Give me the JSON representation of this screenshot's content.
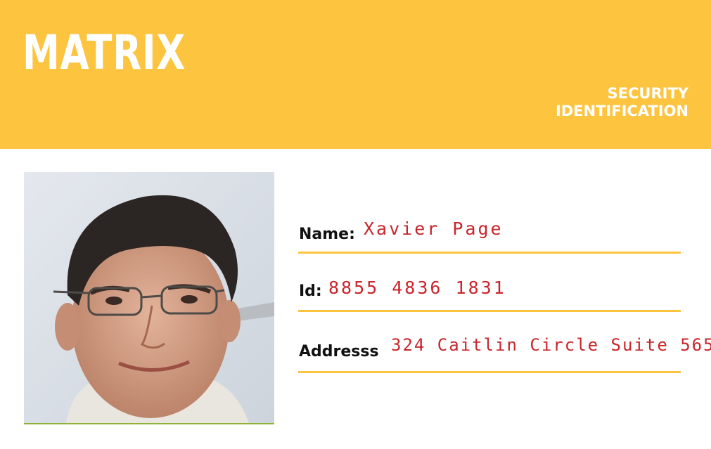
{
  "card": {
    "brand": "MATRIX",
    "subtitle_line1": "SECURITY",
    "subtitle_line2": "IDENTIFICATION",
    "colors": {
      "accent": "#fdc43f",
      "value_text": "#c9252b",
      "label_text": "#111111"
    }
  },
  "fields": {
    "name_label": "Name:",
    "name_value": "Xavier Page",
    "id_label": "Id:",
    "id_value": "8855 4836 1831",
    "address_label": "Addresss",
    "address_value": "324 Caitlin Circle Suite 565"
  },
  "photo": {
    "icon": "person-portrait"
  }
}
